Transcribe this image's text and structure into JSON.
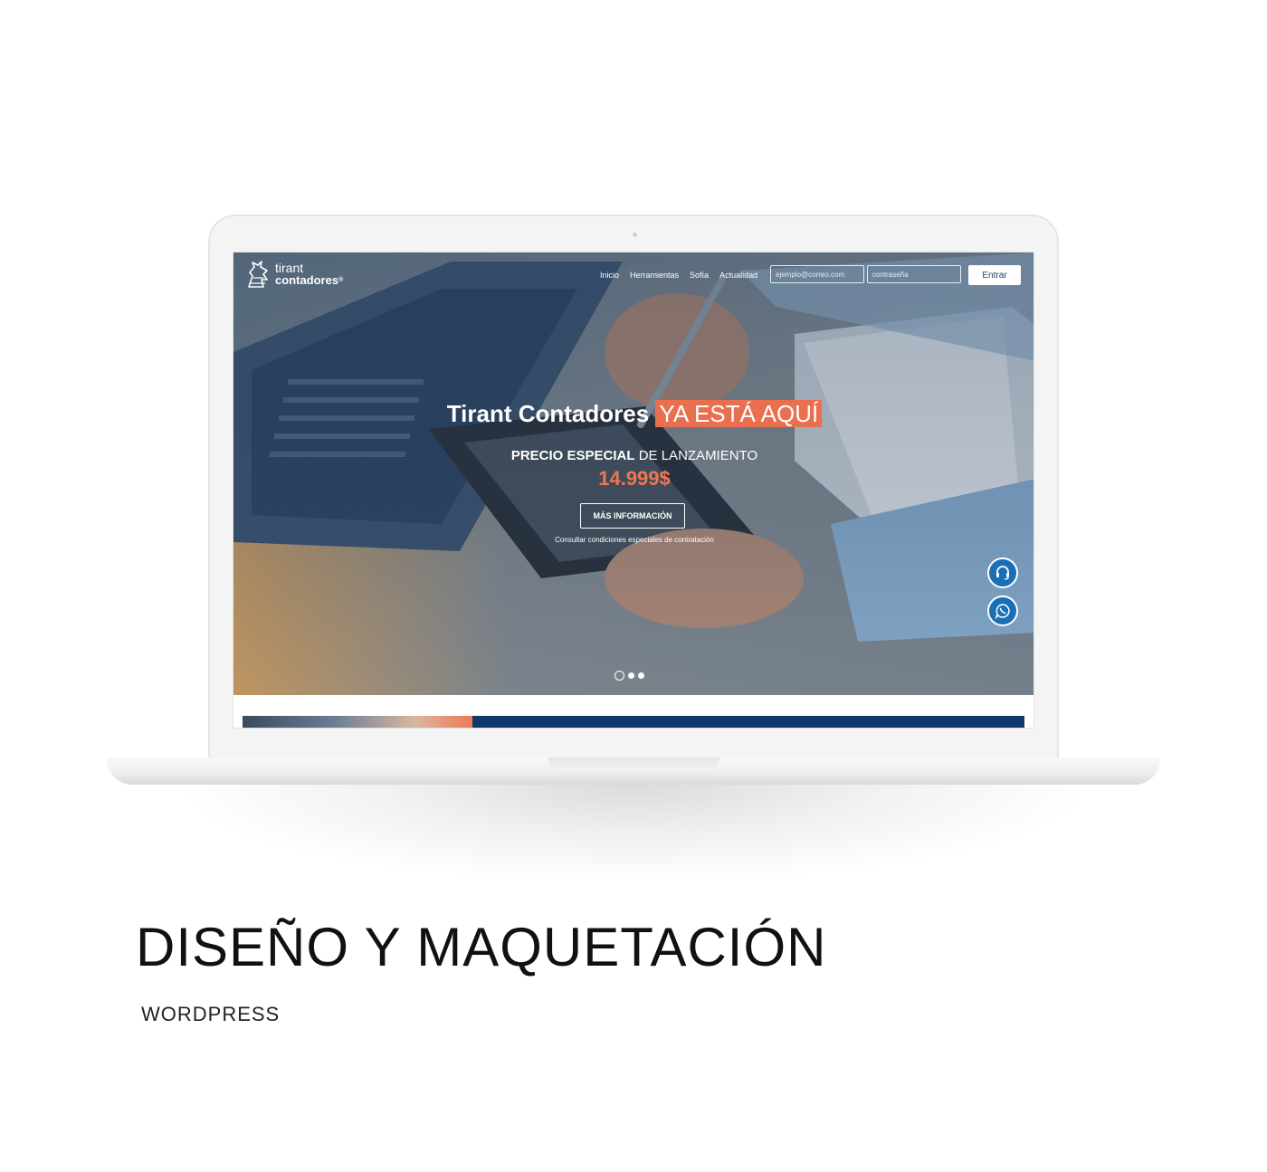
{
  "site": {
    "logo": {
      "line1": "tirant",
      "line2": "contadores",
      "registered": "®"
    },
    "nav": [
      "Inicio",
      "Herramientas",
      "Sofía",
      "Actualidad"
    ],
    "login": {
      "email_placeholder": "ejemplo@correo.com",
      "password_placeholder": "contraseña",
      "submit_label": "Entrar"
    },
    "hero": {
      "headline": "Tirant Contadores",
      "headline_highlight": "YA ESTÁ AQUÍ",
      "sub_bold": "PRECIO ESPECIAL",
      "sub_rest": " DE LANZAMIENTO",
      "price": "14.999$",
      "cta_label": "MÁS INFORMACIÓN",
      "terms": "Consultar condiciones especiales de contratación"
    },
    "slider": {
      "count": 3,
      "active_index": 0
    }
  },
  "captions": {
    "title": "DISEÑO Y MAQUETACIÓN",
    "subtitle": "WORDPRESS"
  },
  "colors": {
    "accent": "#e96f4e",
    "brand_blue": "#1e3f66",
    "floating_button": "#1a6fb5"
  },
  "icons": {
    "support": "headset-icon",
    "whatsapp": "whatsapp-icon"
  }
}
